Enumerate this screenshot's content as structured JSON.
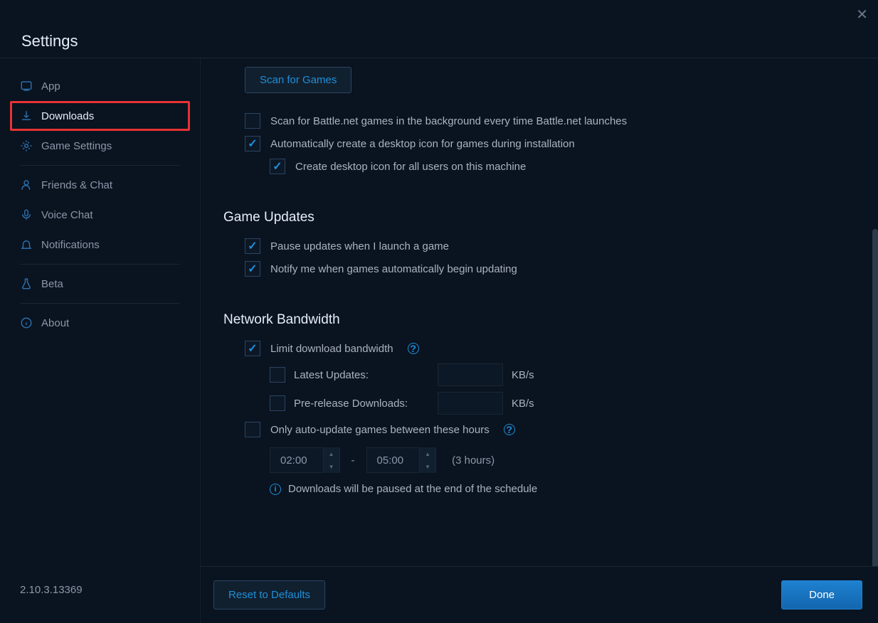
{
  "window_title": "Settings",
  "sidebar": {
    "items": [
      {
        "label": "App",
        "icon": "app"
      },
      {
        "label": "Downloads",
        "icon": "download",
        "highlight": true
      },
      {
        "label": "Game Settings",
        "icon": "gear"
      },
      {
        "label": "Friends & Chat",
        "icon": "friends"
      },
      {
        "label": "Voice Chat",
        "icon": "mic"
      },
      {
        "label": "Notifications",
        "icon": "bell"
      },
      {
        "label": "Beta",
        "icon": "flask"
      },
      {
        "label": "About",
        "icon": "info"
      }
    ],
    "version": "2.10.3.13369"
  },
  "content": {
    "scan_button": "Scan for Games",
    "scan_background": {
      "label": "Scan for Battle.net games in the background every time Battle.net launches",
      "checked": false
    },
    "auto_desktop_icon": {
      "label": "Automatically create a desktop icon for games during installation",
      "checked": true
    },
    "desktop_icon_all_users": {
      "label": "Create desktop icon for all users on this machine",
      "checked": true
    },
    "section_updates": "Game Updates",
    "pause_on_launch": {
      "label": "Pause updates when I launch a game",
      "checked": true
    },
    "notify_auto_update": {
      "label": "Notify me when games automatically begin updating",
      "checked": true
    },
    "section_bandwidth": "Network Bandwidth",
    "limit_bandwidth": {
      "label": "Limit download bandwidth",
      "checked": true
    },
    "latest_updates": {
      "label": "Latest Updates:",
      "checked": false,
      "value": "",
      "unit": "KB/s"
    },
    "prerelease_downloads": {
      "label": "Pre-release Downloads:",
      "checked": false,
      "value": "",
      "unit": "KB/s"
    },
    "auto_update_hours": {
      "label": "Only auto-update games between these hours",
      "checked": false,
      "start": "02:00",
      "end": "05:00",
      "duration": "(3 hours)"
    },
    "schedule_info": "Downloads will be paused at the end of the schedule"
  },
  "footer": {
    "reset": "Reset to Defaults",
    "done": "Done"
  }
}
